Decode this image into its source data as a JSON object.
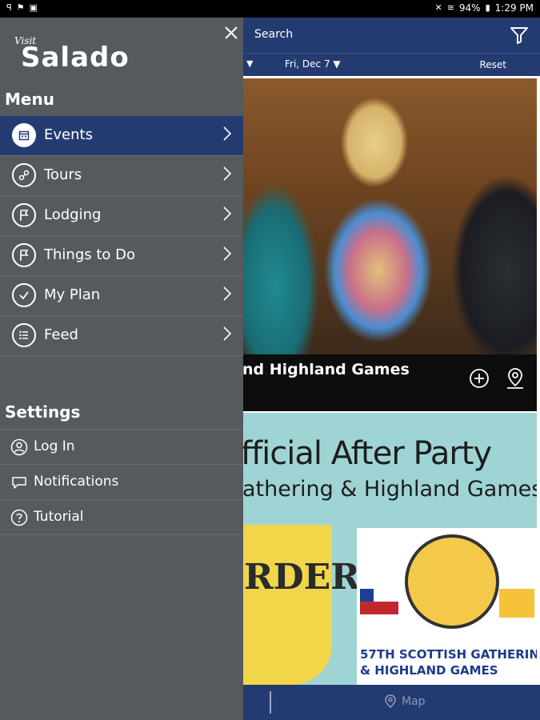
{
  "status_bar": {
    "battery": "94%",
    "time": "1:29 PM"
  },
  "top_bar": {
    "search_label": "Search"
  },
  "filter_bar": {
    "date_filter": "Fri, Dec 7",
    "reset_label": "Reset"
  },
  "events": [
    {
      "title": "nd Highland Games"
    },
    {
      "headline": "fficial After Party",
      "subline": "athering & Highland Games",
      "left_logo_text": "RDER",
      "right_logo_caption_1": "57TH SCOTTISH GATHERIN",
      "right_logo_caption_2": "& HIGHLAND GAMES"
    }
  ],
  "bottom_nav": {
    "map_label": "Map"
  },
  "drawer": {
    "brand_small": "Visit",
    "brand_big": "Salado",
    "menu_title": "Menu",
    "menu_items": [
      {
        "label": "Events",
        "icon": "calendar-icon",
        "active": true
      },
      {
        "label": "Tours",
        "icon": "tour-route-icon",
        "active": false
      },
      {
        "label": "Lodging",
        "icon": "flag-icon",
        "active": false
      },
      {
        "label": "Things to Do",
        "icon": "flag-icon",
        "active": false
      },
      {
        "label": "My Plan",
        "icon": "checkmark-icon",
        "active": false
      },
      {
        "label": "Feed",
        "icon": "list-icon",
        "active": false
      }
    ],
    "settings_title": "Settings",
    "settings_items": [
      {
        "label": "Log In",
        "icon": "user-icon"
      },
      {
        "label": "Notifications",
        "icon": "speech-bubble-icon"
      },
      {
        "label": "Tutorial",
        "icon": "question-icon"
      }
    ]
  },
  "colors": {
    "navy": "#243b72",
    "drawer_gray": "#555a5e",
    "teal_card": "#9fd4d4"
  }
}
